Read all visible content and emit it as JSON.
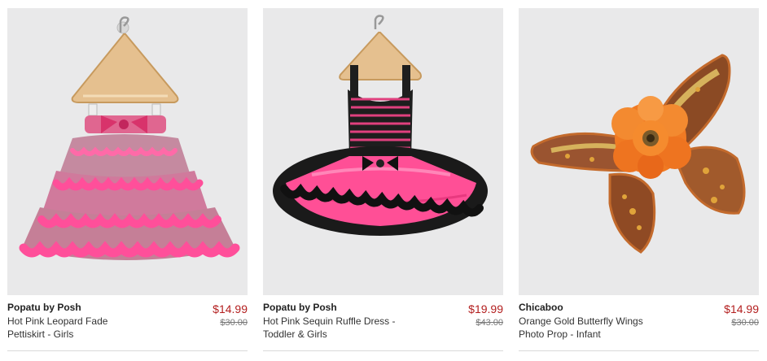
{
  "products": [
    {
      "brand": "Popatu by Posh",
      "name_line1": "Hot Pink Leopard Fade",
      "name_line2": "Pettiskirt - Girls",
      "price": "$14.99",
      "original_price": "$30.00",
      "image": "pink-leopard-pettiskirt-on-hanger"
    },
    {
      "brand": "Popatu by Posh",
      "name_line1": "Hot Pink Sequin Ruffle Dress -",
      "name_line2": "Toddler & Girls",
      "price": "$19.99",
      "original_price": "$43.00",
      "image": "pink-black-ruffle-dress-on-hanger"
    },
    {
      "brand": "Chicaboo",
      "name_line1": "Orange Gold Butterfly Wings",
      "name_line2": "Photo Prop - Infant",
      "price": "$14.99",
      "original_price": "$30.00",
      "image": "orange-gold-butterfly-wings"
    }
  ],
  "colors": {
    "sale_price": "#b31f1f",
    "image_background": "#e9e9ea"
  }
}
